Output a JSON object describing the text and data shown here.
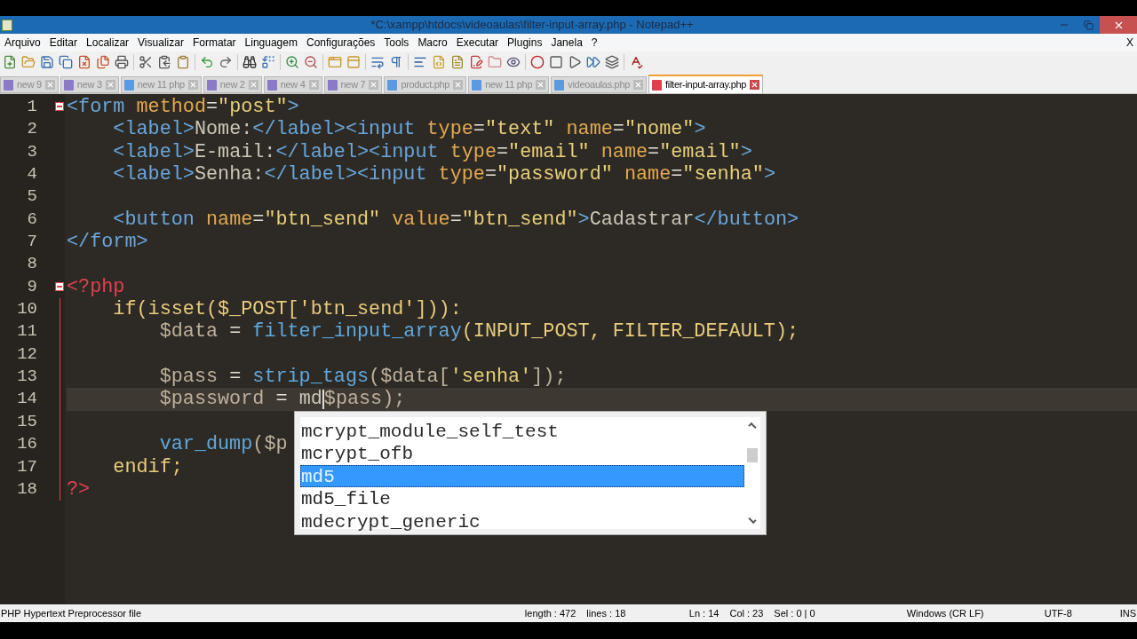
{
  "window": {
    "title": "*C:\\xampp\\htdocs\\videoaulas\\filter-input-array.php - Notepad++"
  },
  "menu": {
    "items": [
      "Arquivo",
      "Editar",
      "Localizar",
      "Visualizar",
      "Formatar",
      "Linguagem",
      "Configurações",
      "Tools",
      "Macro",
      "Executar",
      "Plugins",
      "Janela",
      "?"
    ],
    "close_label": "X"
  },
  "tabs": [
    {
      "label": "new 9",
      "kind": "new",
      "selected": false
    },
    {
      "label": "new 3",
      "kind": "new",
      "selected": false
    },
    {
      "label": "new 11 php",
      "kind": "saved",
      "selected": false
    },
    {
      "label": "new 2",
      "kind": "new",
      "selected": false
    },
    {
      "label": "new 4",
      "kind": "new",
      "selected": false
    },
    {
      "label": "new 7",
      "kind": "new",
      "selected": false
    },
    {
      "label": "product.php",
      "kind": "saved",
      "selected": false
    },
    {
      "label": "new 11 php",
      "kind": "saved",
      "selected": false
    },
    {
      "label": "videoaulas.php",
      "kind": "saved",
      "selected": false
    },
    {
      "label": "filter-input-array.php",
      "kind": "modified",
      "selected": true
    }
  ],
  "editor": {
    "lines": [
      {
        "number": "1",
        "current": false,
        "fold_start": true,
        "fold_line": false,
        "tokens": [
          {
            "kind": "tag",
            "text": "<form"
          },
          {
            "kind": "attr",
            "text": " method"
          },
          {
            "kind": "op",
            "text": "="
          },
          {
            "kind": "string",
            "text": "\"post\""
          },
          {
            "kind": "tag",
            "text": ">"
          }
        ]
      },
      {
        "number": "2",
        "current": false,
        "fold_start": false,
        "fold_line": false,
        "tokens": [
          {
            "kind": "tag",
            "text": "    <label>"
          },
          {
            "kind": "text",
            "text": "Nome:"
          },
          {
            "kind": "tag",
            "text": "</label><input"
          },
          {
            "kind": "attr",
            "text": " type"
          },
          {
            "kind": "op",
            "text": "="
          },
          {
            "kind": "string",
            "text": "\"text\""
          },
          {
            "kind": "attr",
            "text": " name"
          },
          {
            "kind": "op",
            "text": "="
          },
          {
            "kind": "string",
            "text": "\"nome\""
          },
          {
            "kind": "tag",
            "text": ">"
          }
        ]
      },
      {
        "number": "3",
        "current": false,
        "fold_start": false,
        "fold_line": false,
        "tokens": [
          {
            "kind": "tag",
            "text": "    <label>"
          },
          {
            "kind": "text",
            "text": "E-mail:"
          },
          {
            "kind": "tag",
            "text": "</label><input"
          },
          {
            "kind": "attr",
            "text": " type"
          },
          {
            "kind": "op",
            "text": "="
          },
          {
            "kind": "string",
            "text": "\"email\""
          },
          {
            "kind": "attr",
            "text": " name"
          },
          {
            "kind": "op",
            "text": "="
          },
          {
            "kind": "string",
            "text": "\"email\""
          },
          {
            "kind": "tag",
            "text": ">"
          }
        ]
      },
      {
        "number": "4",
        "current": false,
        "fold_start": false,
        "fold_line": false,
        "tokens": [
          {
            "kind": "tag",
            "text": "    <label>"
          },
          {
            "kind": "text",
            "text": "Senha:"
          },
          {
            "kind": "tag",
            "text": "</label><input"
          },
          {
            "kind": "attr",
            "text": " type"
          },
          {
            "kind": "op",
            "text": "="
          },
          {
            "kind": "string",
            "text": "\"password\""
          },
          {
            "kind": "attr",
            "text": " name"
          },
          {
            "kind": "op",
            "text": "="
          },
          {
            "kind": "string",
            "text": "\"senha\""
          },
          {
            "kind": "tag",
            "text": ">"
          }
        ]
      },
      {
        "number": "5",
        "current": false,
        "fold_start": false,
        "fold_line": false
      },
      {
        "number": "6",
        "current": false,
        "fold_start": false,
        "fold_line": false,
        "tokens": [
          {
            "kind": "tag",
            "text": "    <button"
          },
          {
            "kind": "attr",
            "text": " name"
          },
          {
            "kind": "op",
            "text": "="
          },
          {
            "kind": "string",
            "text": "\"btn_send\""
          },
          {
            "kind": "attr",
            "text": " value"
          },
          {
            "kind": "op",
            "text": "="
          },
          {
            "kind": "string",
            "text": "\"btn_send\""
          },
          {
            "kind": "tag",
            "text": ">"
          },
          {
            "kind": "text",
            "text": "Cadastrar"
          },
          {
            "kind": "tag",
            "text": "</button>"
          }
        ]
      },
      {
        "number": "7",
        "current": false,
        "fold_start": false,
        "fold_line": false,
        "tokens": [
          {
            "kind": "tag",
            "text": "</form>"
          }
        ]
      },
      {
        "number": "8",
        "current": false,
        "fold_start": false,
        "fold_line": false
      },
      {
        "number": "9",
        "current": false,
        "fold_start": true,
        "fold_line": false,
        "tokens": [
          {
            "kind": "php",
            "text": "<?php"
          }
        ]
      },
      {
        "number": "10",
        "current": false,
        "fold_start": false,
        "fold_line": true,
        "tokens": [
          {
            "kind": "keyword",
            "text": "    if(isset($_POST['btn_send'])):"
          }
        ]
      },
      {
        "number": "11",
        "current": false,
        "fold_start": false,
        "fold_line": true,
        "tokens": [
          {
            "kind": "var",
            "text": "        $data"
          },
          {
            "kind": "op",
            "text": " = "
          },
          {
            "kind": "func",
            "text": "filter_input_array"
          },
          {
            "kind": "const",
            "text": "(INPUT_POST, FILTER_DEFAULT);"
          }
        ]
      },
      {
        "number": "12",
        "current": false,
        "fold_start": false,
        "fold_line": true
      },
      {
        "number": "13",
        "current": false,
        "fold_start": false,
        "fold_line": true,
        "tokens": [
          {
            "kind": "var",
            "text": "        $pass"
          },
          {
            "kind": "op",
            "text": " = "
          },
          {
            "kind": "func",
            "text": "strip_tags"
          },
          {
            "kind": "var",
            "text": "($data["
          },
          {
            "kind": "string",
            "text": "'senha'"
          },
          {
            "kind": "var",
            "text": "]);"
          }
        ]
      },
      {
        "number": "14",
        "current": true,
        "fold_start": false,
        "fold_line": true,
        "tokens": [
          {
            "kind": "var",
            "text": "        $password"
          },
          {
            "kind": "op",
            "text": " = "
          },
          {
            "kind": "text",
            "text": "md"
          },
          {
            "kind": "caret"
          },
          {
            "kind": "var",
            "text": "$pass);"
          }
        ]
      },
      {
        "number": "15",
        "current": false,
        "fold_start": false,
        "fold_line": true
      },
      {
        "number": "16",
        "current": false,
        "fold_start": false,
        "fold_line": true,
        "tokens": [
          {
            "kind": "func",
            "text": "        var_dump"
          },
          {
            "kind": "var",
            "text": "($p"
          }
        ]
      },
      {
        "number": "17",
        "current": false,
        "fold_start": false,
        "fold_line": true,
        "tokens": [
          {
            "kind": "keyword",
            "text": "    endif;"
          }
        ]
      },
      {
        "number": "18",
        "current": false,
        "fold_start": false,
        "fold_line": true,
        "tokens": [
          {
            "kind": "php",
            "text": "?>"
          }
        ]
      }
    ]
  },
  "autocomplete": {
    "items": [
      {
        "label": "mcrypt_module_self_test",
        "selected": false
      },
      {
        "label": "mcrypt_ofb",
        "selected": false
      },
      {
        "label": "md5",
        "selected": true
      },
      {
        "label": "md5_file",
        "selected": false
      },
      {
        "label": "mdecrypt_generic",
        "selected": false
      }
    ]
  },
  "status_bar": [
    {
      "texts": [
        "PHP Hypertext Preprocessor file"
      ]
    },
    {
      "texts": [
        "length : 472",
        "lines : 18"
      ]
    },
    {
      "texts": [
        "Ln : 14",
        "Col : 23",
        "Sel : 0 | 0"
      ]
    },
    {
      "texts": [
        "Windows (CR LF)"
      ]
    },
    {
      "texts": [
        "UTF-8"
      ]
    },
    {
      "texts": [
        "INS"
      ]
    }
  ]
}
